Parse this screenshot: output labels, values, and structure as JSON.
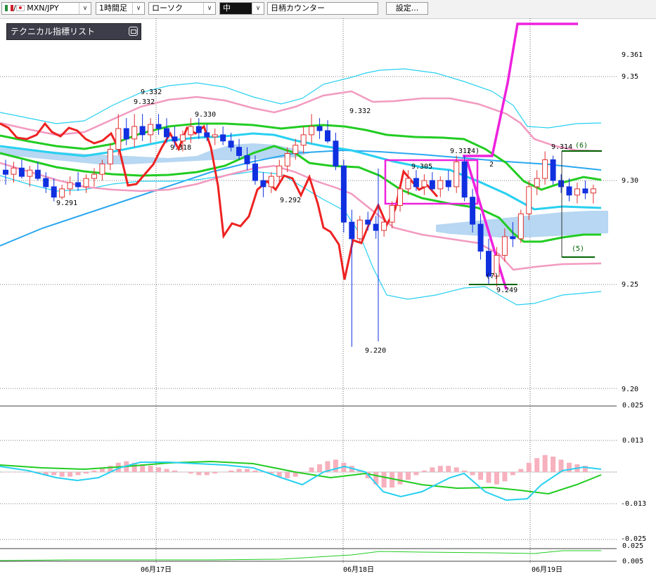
{
  "toolbar": {
    "pair": "MXN/JPY",
    "pair_separator": "/",
    "timeframe": "1時間足",
    "chart_type": "ローソク",
    "size": "中",
    "ticker_checkbox_label": "日柄カウンター",
    "settings_label": "設定..."
  },
  "indicator_panel": {
    "title": "テクニカル指標リスト"
  },
  "price_axis": {
    "labels": [
      "9.361",
      "9.35",
      "9.30",
      "9.25",
      "9.20"
    ]
  },
  "macd_axis": {
    "labels": [
      "0.025",
      "0.013",
      "-0.013",
      "-0.025"
    ]
  },
  "sub_axis": {
    "labels": [
      "0.025",
      "0.005"
    ]
  },
  "date_axis": {
    "labels": [
      "06月17日",
      "06月18日",
      "06月19日"
    ]
  },
  "annotations": {
    "h1": "9.332",
    "h2": "9.332",
    "h3": "9.330",
    "h4": "9.318",
    "h5": "9.332",
    "h6": "9.305",
    "h7": "9.312",
    "h8": "9.314",
    "l1": "9.291",
    "l2": "9.292",
    "l3": "9.220",
    "l4": "9.249",
    "c6": "(6)",
    "c5": "(5)",
    "c7": "(7)",
    "c4": "(4)",
    "n2": "2"
  },
  "colors": {
    "bull_candle": "#e03030",
    "bear_candle": "#1030e0",
    "ma_green": "#22cc22",
    "ma_red": "#ee2222",
    "bb_pink": "#f29ac0",
    "bb_cyan": "#28d0f0",
    "ma_blue": "#2aa8f0",
    "magenta": "#ee22dd",
    "cloud": "#aad0f0"
  },
  "chart_data": {
    "type": "candlestick",
    "pair": "MXN/JPY",
    "timeframe": "1時間足",
    "ylim": [
      9.2,
      9.361
    ],
    "y_ticks": [
      9.2,
      9.25,
      9.3,
      9.35,
      9.361
    ],
    "x_labels": [
      "06月17日",
      "06月18日",
      "06月19日"
    ],
    "candles": [
      [
        9.305,
        9.31,
        9.298,
        9.303
      ],
      [
        9.303,
        9.309,
        9.299,
        9.306
      ],
      [
        9.306,
        9.31,
        9.301,
        9.302
      ],
      [
        9.302,
        9.307,
        9.297,
        9.305
      ],
      [
        9.305,
        9.309,
        9.3,
        9.301
      ],
      [
        9.301,
        9.304,
        9.294,
        9.297
      ],
      [
        9.297,
        9.301,
        9.29,
        9.292
      ],
      [
        9.292,
        9.298,
        9.291,
        9.296
      ],
      [
        9.296,
        9.302,
        9.293,
        9.299
      ],
      [
        9.299,
        9.304,
        9.295,
        9.297
      ],
      [
        9.297,
        9.303,
        9.294,
        9.301
      ],
      [
        9.301,
        9.306,
        9.297,
        9.303
      ],
      [
        9.303,
        9.31,
        9.3,
        9.308
      ],
      [
        9.308,
        9.318,
        9.305,
        9.315
      ],
      [
        9.315,
        9.332,
        9.312,
        9.325
      ],
      [
        9.325,
        9.33,
        9.317,
        9.32
      ],
      [
        9.32,
        9.332,
        9.316,
        9.326
      ],
      [
        9.326,
        9.332,
        9.319,
        9.322
      ],
      [
        9.322,
        9.33,
        9.318,
        9.327
      ],
      [
        9.327,
        9.332,
        9.322,
        9.325
      ],
      [
        9.325,
        9.33,
        9.318,
        9.321
      ],
      [
        9.321,
        9.326,
        9.316,
        9.319
      ],
      [
        9.319,
        9.324,
        9.314,
        9.322
      ],
      [
        9.322,
        9.33,
        9.318,
        9.326
      ],
      [
        9.326,
        9.33,
        9.32,
        9.323
      ],
      [
        9.323,
        9.327,
        9.319,
        9.321
      ],
      [
        9.321,
        9.325,
        9.317,
        9.322
      ],
      [
        9.322,
        9.326,
        9.317,
        9.319
      ],
      [
        9.319,
        9.323,
        9.314,
        9.316
      ],
      [
        9.316,
        9.32,
        9.31,
        9.312
      ],
      [
        9.312,
        9.316,
        9.305,
        9.308
      ],
      [
        9.308,
        9.312,
        9.298,
        9.3
      ],
      [
        9.3,
        9.304,
        9.292,
        9.297
      ],
      [
        9.297,
        9.304,
        9.294,
        9.302
      ],
      [
        9.302,
        9.31,
        9.299,
        9.307
      ],
      [
        9.307,
        9.316,
        9.304,
        9.313
      ],
      [
        9.313,
        9.32,
        9.31,
        9.317
      ],
      [
        9.317,
        9.326,
        9.313,
        9.322
      ],
      [
        9.322,
        9.332,
        9.318,
        9.326
      ],
      [
        9.326,
        9.33,
        9.32,
        9.324
      ],
      [
        9.324,
        9.329,
        9.318,
        9.319
      ],
      [
        9.319,
        9.323,
        9.305,
        9.307
      ],
      [
        9.307,
        9.31,
        9.275,
        9.28
      ],
      [
        9.28,
        9.286,
        9.22,
        9.272
      ],
      [
        9.272,
        9.283,
        9.27,
        9.281
      ],
      [
        9.281,
        9.285,
        9.276,
        9.279
      ],
      [
        9.279,
        9.283,
        9.272,
        9.276
      ],
      [
        9.276,
        9.282,
        9.273,
        9.28
      ],
      [
        9.28,
        9.29,
        9.277,
        9.288
      ],
      [
        9.288,
        9.298,
        9.285,
        9.296
      ],
      [
        9.296,
        9.305,
        9.293,
        9.301
      ],
      [
        9.301,
        9.305,
        9.295,
        9.297
      ],
      [
        9.297,
        9.303,
        9.293,
        9.3
      ],
      [
        9.3,
        9.304,
        9.295,
        9.296
      ],
      [
        9.296,
        9.302,
        9.292,
        9.3
      ],
      [
        9.3,
        9.305,
        9.295,
        9.297
      ],
      [
        9.297,
        9.312,
        9.294,
        9.309
      ],
      [
        9.309,
        9.312,
        9.29,
        9.292
      ],
      [
        9.292,
        9.296,
        9.275,
        9.279
      ],
      [
        9.279,
        9.284,
        9.262,
        9.266
      ],
      [
        9.266,
        9.272,
        9.25,
        9.254
      ],
      [
        9.254,
        9.268,
        9.249,
        9.264
      ],
      [
        9.264,
        9.277,
        9.261,
        9.273
      ],
      [
        9.273,
        9.28,
        9.268,
        9.272
      ],
      [
        9.272,
        9.286,
        9.27,
        9.284
      ],
      [
        9.284,
        9.3,
        9.281,
        9.297
      ],
      [
        9.297,
        9.305,
        9.293,
        9.301
      ],
      [
        9.301,
        9.314,
        9.298,
        9.31
      ],
      [
        9.31,
        9.312,
        9.298,
        9.3
      ],
      [
        9.3,
        9.303,
        9.294,
        9.297
      ],
      [
        9.297,
        9.301,
        9.29,
        9.293
      ],
      [
        9.293,
        9.299,
        9.289,
        9.296
      ],
      [
        9.296,
        9.3,
        9.291,
        9.294
      ],
      [
        9.294,
        9.298,
        9.289,
        9.296
      ]
    ],
    "candle_format": "open,high,low,close"
  }
}
